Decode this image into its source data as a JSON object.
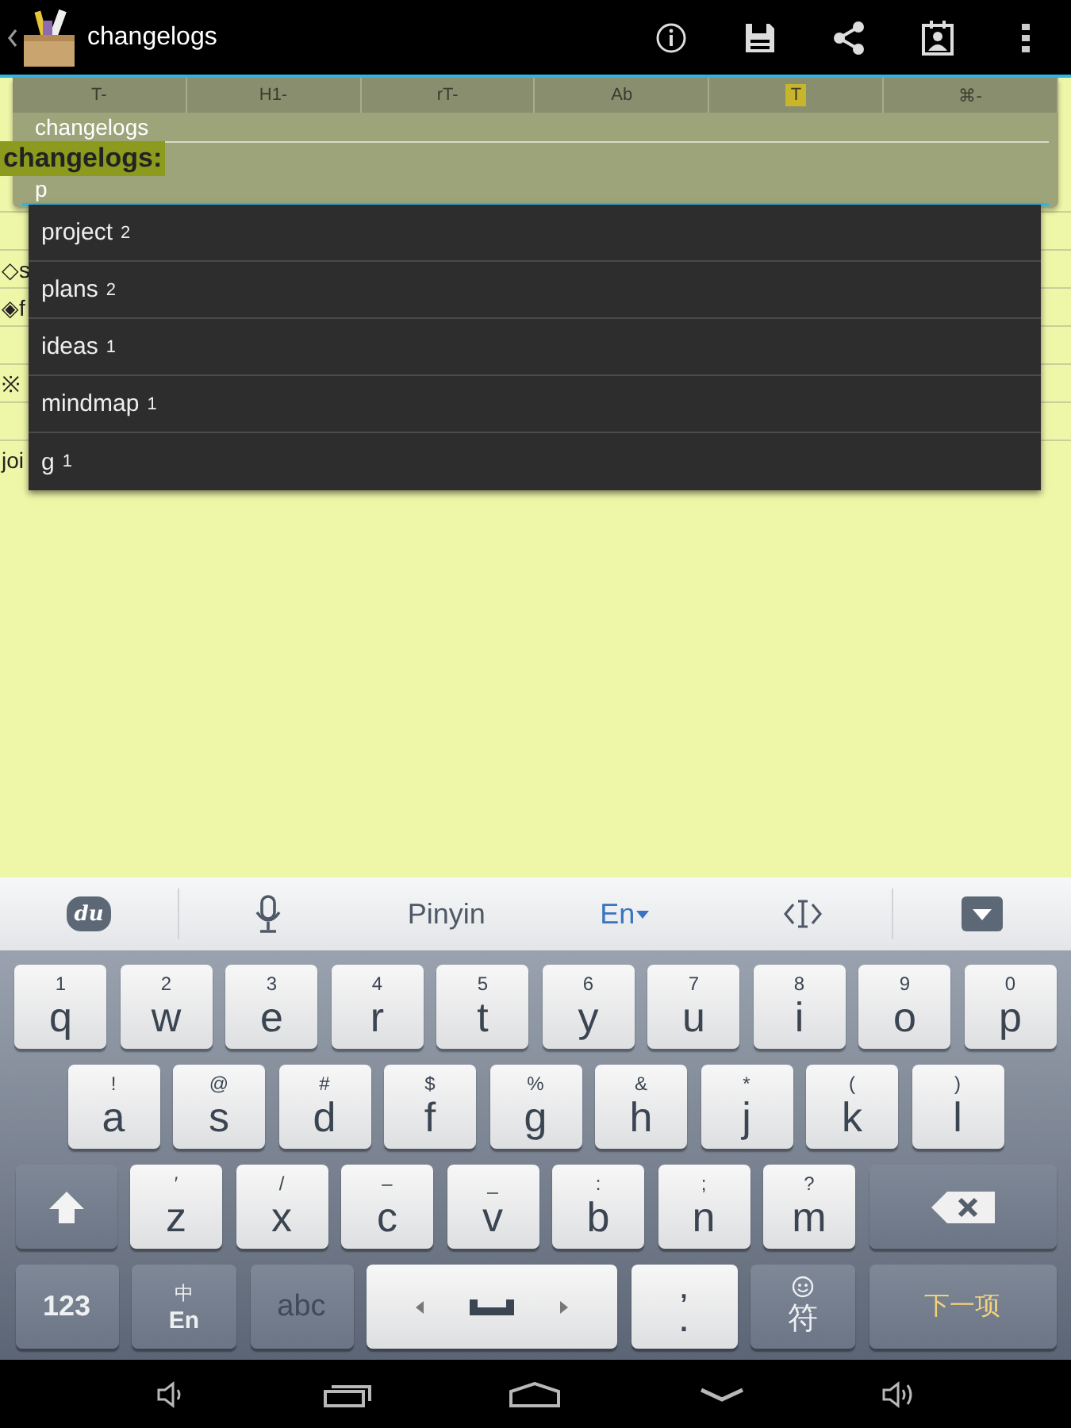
{
  "action_bar": {
    "title": "changelogs"
  },
  "note": {
    "lines": [
      {
        "kind": "blank"
      },
      {
        "kind": "text",
        "text": "◇s"
      },
      {
        "kind": "text",
        "text": "◈f"
      },
      {
        "kind": "blank"
      },
      {
        "kind": "text",
        "text": "※"
      },
      {
        "kind": "blank"
      },
      {
        "kind": "text",
        "text": "joi"
      }
    ]
  },
  "editor": {
    "tools": [
      {
        "label": "T-",
        "highlighted": false
      },
      {
        "label": "H1-",
        "highlighted": false
      },
      {
        "label": "rT-",
        "highlighted": false
      },
      {
        "label": "Ab",
        "highlighted": false
      },
      {
        "label": "T",
        "highlighted": true
      },
      {
        "label": "⌘-",
        "highlighted": false
      }
    ],
    "name_field": "changelogs",
    "heading": "changelogs:",
    "input": "p"
  },
  "suggestions": [
    {
      "tag": "project",
      "count": "2"
    },
    {
      "tag": "plans",
      "count": "2"
    },
    {
      "tag": "ideas",
      "count": "1"
    },
    {
      "tag": "mindmap",
      "count": "1"
    },
    {
      "tag": "g",
      "count": "1"
    }
  ],
  "keyboard": {
    "toolbar": {
      "logo": "du",
      "mode": "Pinyin",
      "language": "En"
    },
    "rows": [
      {
        "keys": [
          {
            "kind": "letter",
            "main": "q",
            "sub": "1"
          },
          {
            "kind": "letter",
            "main": "w",
            "sub": "2"
          },
          {
            "kind": "letter",
            "main": "e",
            "sub": "3"
          },
          {
            "kind": "letter",
            "main": "r",
            "sub": "4"
          },
          {
            "kind": "letter",
            "main": "t",
            "sub": "5"
          },
          {
            "kind": "letter",
            "main": "y",
            "sub": "6"
          },
          {
            "kind": "letter",
            "main": "u",
            "sub": "7"
          },
          {
            "kind": "letter",
            "main": "i",
            "sub": "8"
          },
          {
            "kind": "letter",
            "main": "o",
            "sub": "9"
          },
          {
            "kind": "letter",
            "main": "p",
            "sub": "0"
          }
        ]
      },
      {
        "keys": [
          {
            "kind": "letter",
            "main": "a",
            "sub": "!"
          },
          {
            "kind": "letter",
            "main": "s",
            "sub": "@"
          },
          {
            "kind": "letter",
            "main": "d",
            "sub": "#"
          },
          {
            "kind": "letter",
            "main": "f",
            "sub": "$"
          },
          {
            "kind": "letter",
            "main": "g",
            "sub": "%"
          },
          {
            "kind": "letter",
            "main": "h",
            "sub": "&"
          },
          {
            "kind": "letter",
            "main": "j",
            "sub": "*"
          },
          {
            "kind": "letter",
            "main": "k",
            "sub": "("
          },
          {
            "kind": "letter",
            "main": "l",
            "sub": ")"
          }
        ]
      },
      {
        "keys": [
          {
            "kind": "shift"
          },
          {
            "kind": "letter",
            "main": "z",
            "sub": "′"
          },
          {
            "kind": "letter",
            "main": "x",
            "sub": "/"
          },
          {
            "kind": "letter",
            "main": "c",
            "sub": "–"
          },
          {
            "kind": "letter",
            "main": "v",
            "sub": "_"
          },
          {
            "kind": "letter",
            "main": "b",
            "sub": ":"
          },
          {
            "kind": "letter",
            "main": "n",
            "sub": ";"
          },
          {
            "kind": "letter",
            "main": "m",
            "sub": "?"
          },
          {
            "kind": "backspace"
          }
        ]
      },
      {
        "keys": [
          {
            "kind": "function",
            "main": "123"
          },
          {
            "kind": "lang",
            "main": "En",
            "sub": "中"
          },
          {
            "kind": "mode",
            "main": "abc"
          },
          {
            "kind": "space"
          },
          {
            "kind": "punct",
            "main": ".",
            "sub": ","
          },
          {
            "kind": "symbol",
            "main": "符"
          },
          {
            "kind": "enter",
            "main": "下一项"
          }
        ]
      }
    ]
  }
}
